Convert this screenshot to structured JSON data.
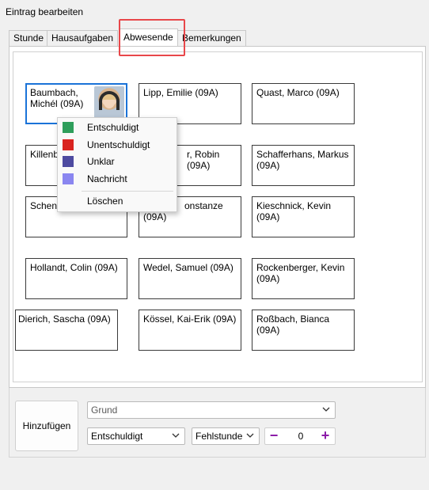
{
  "window": {
    "title": "Eintrag bearbeiten"
  },
  "tabs": [
    {
      "label": "Stunde"
    },
    {
      "label": "Hausaufgaben"
    },
    {
      "label": "Abwesende"
    },
    {
      "label": "Bemerkungen"
    }
  ],
  "students": [
    {
      "line1": "Baumbach,",
      "line2": "Michél (09A)"
    },
    {
      "line1": "Lipp, Emilie (09A)",
      "line2": ""
    },
    {
      "line1": "Quast, Marco (09A)",
      "line2": ""
    },
    {
      "line1": "Killenb",
      "line2": ""
    },
    {
      "line1": "r, Robin (09A)",
      "line2": ""
    },
    {
      "line1": "Schafferhans, Markus",
      "line2": "(09A)"
    },
    {
      "line1": "Schenk",
      "line2": ""
    },
    {
      "line1": "onstanze",
      "line2": "(09A)"
    },
    {
      "line1": "Kieschnick, Kevin (09A)",
      "line2": ""
    },
    {
      "line1": "Hollandt, Colin (09A)",
      "line2": ""
    },
    {
      "line1": "Wedel, Samuel (09A)",
      "line2": ""
    },
    {
      "line1": "Rockenberger, Kevin",
      "line2": "(09A)"
    },
    {
      "line1": "Dierich, Sascha (09A)",
      "line2": ""
    },
    {
      "line1": "Kössel, Kai-Erik (09A)",
      "line2": ""
    },
    {
      "line1": "Roßbach, Bianca (09A)",
      "line2": ""
    }
  ],
  "context_menu": {
    "items": [
      {
        "label": "Entschuldigt",
        "color": "#2e9e5b"
      },
      {
        "label": "Unentschuldigt",
        "color": "#d9231f"
      },
      {
        "label": "Unklar",
        "color": "#4d4aa0"
      },
      {
        "label": "Nachricht",
        "color": "#8a86f0"
      }
    ],
    "delete_label": "Löschen"
  },
  "bottom": {
    "add_button": "Hinzufügen",
    "reason_placeholder": "Grund",
    "status_value": "Entschuldigt",
    "type_value": "Fehlstunde",
    "count_value": "0"
  },
  "colors": {
    "accent_selected": "#1a73d8",
    "tab_highlight": "#e8474a",
    "stepper": "#8b1aa8"
  }
}
